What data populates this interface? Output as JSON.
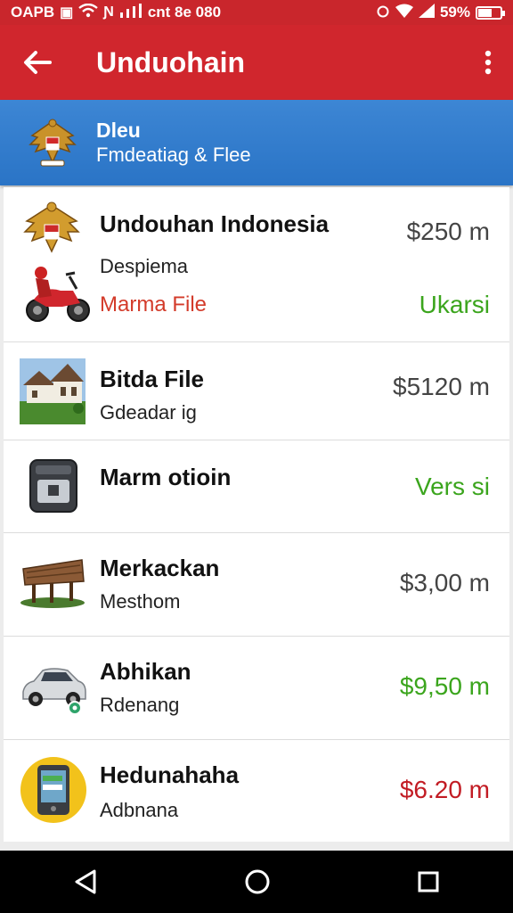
{
  "status_bar": {
    "left_text": "OAPB",
    "carrier_text": "cnt 8e 080",
    "battery": "59%",
    "battery_level": 0.59
  },
  "app_bar": {
    "title": "Unduohain"
  },
  "header": {
    "title": "Dleu",
    "subtitle": "Fmdeatiag & Flee"
  },
  "items": [
    {
      "name": "Undouhan Indonesia",
      "subtitle": "Despiema",
      "detail": "Marma File",
      "price": "$250 m",
      "status": "Ukarsi",
      "icons": [
        "garuda-emblem",
        "motorcycle"
      ]
    },
    {
      "name": "Bitda File",
      "subtitle": "Gdeadar ig",
      "price": "$5120 m",
      "icons": [
        "house"
      ]
    },
    {
      "name": "Marm otioin",
      "status": "Vers si",
      "icons": [
        "device"
      ]
    },
    {
      "name": "Merkackan",
      "subtitle": "Mesthom",
      "price": "$3,00 m",
      "icons": [
        "traditional-house"
      ]
    },
    {
      "name": "Abhikan",
      "subtitle": "Rdenang",
      "price": "$9,50 m",
      "icons": [
        "car"
      ]
    },
    {
      "name": "Hedunahaha",
      "subtitle": "Adbnana",
      "price": "$6.20 m",
      "icons": [
        "phone"
      ]
    }
  ],
  "colors": {
    "app_bar": "#d0262d",
    "header": "#2a74c6",
    "price_green": "#3ba51d",
    "price_red": "#c21c24",
    "detail_red": "#d33b2a"
  }
}
